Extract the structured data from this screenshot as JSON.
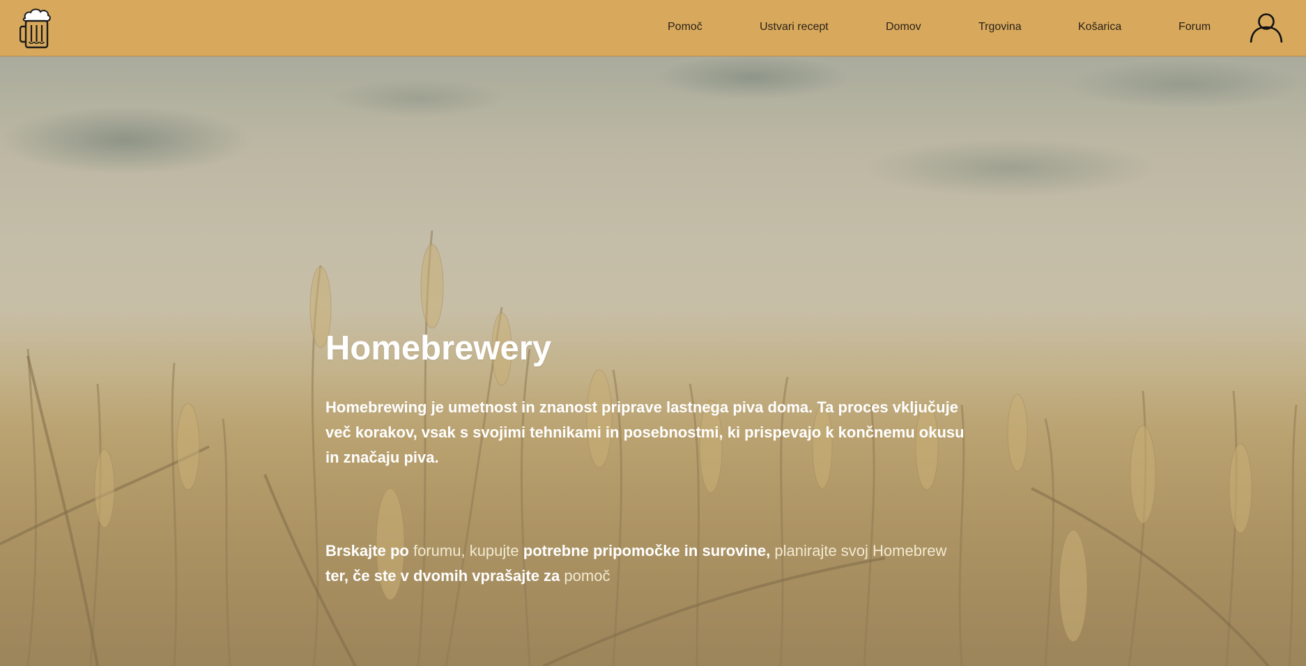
{
  "header": {
    "logo_icon": "beer-mug-icon",
    "nav": [
      {
        "label": "Pomoč"
      },
      {
        "label": "Ustvari recept"
      },
      {
        "label": "Domov"
      },
      {
        "label": "Trgovina"
      },
      {
        "label": "Košarica"
      },
      {
        "label": "Forum"
      }
    ],
    "user_icon": "user-icon"
  },
  "hero": {
    "title": "Homebrewery",
    "paragraph1": "Homebrewing je umetnost in znanost priprave lastnega piva doma. Ta proces vključuje več korakov, vsak s svojimi tehnikami in posebnostmi, ki prispevajo k končnemu okusu in značaju piva.",
    "paragraph2": {
      "t1": "Brskajte po",
      "link_forum": "forumu",
      "comma": ",",
      "link_buy": "kupujte",
      "t2": "potrebne pripomočke in surovine,",
      "link_plan": "planirajte svoj Homebrew",
      "t3": "ter, če ste v dvomih vprašajte za",
      "link_help": "pomoč"
    }
  },
  "colors": {
    "header_bg": "#d8a95c",
    "text": "#2b2118",
    "hero_text": "#ffffff",
    "link_text": "#f3ead2"
  }
}
